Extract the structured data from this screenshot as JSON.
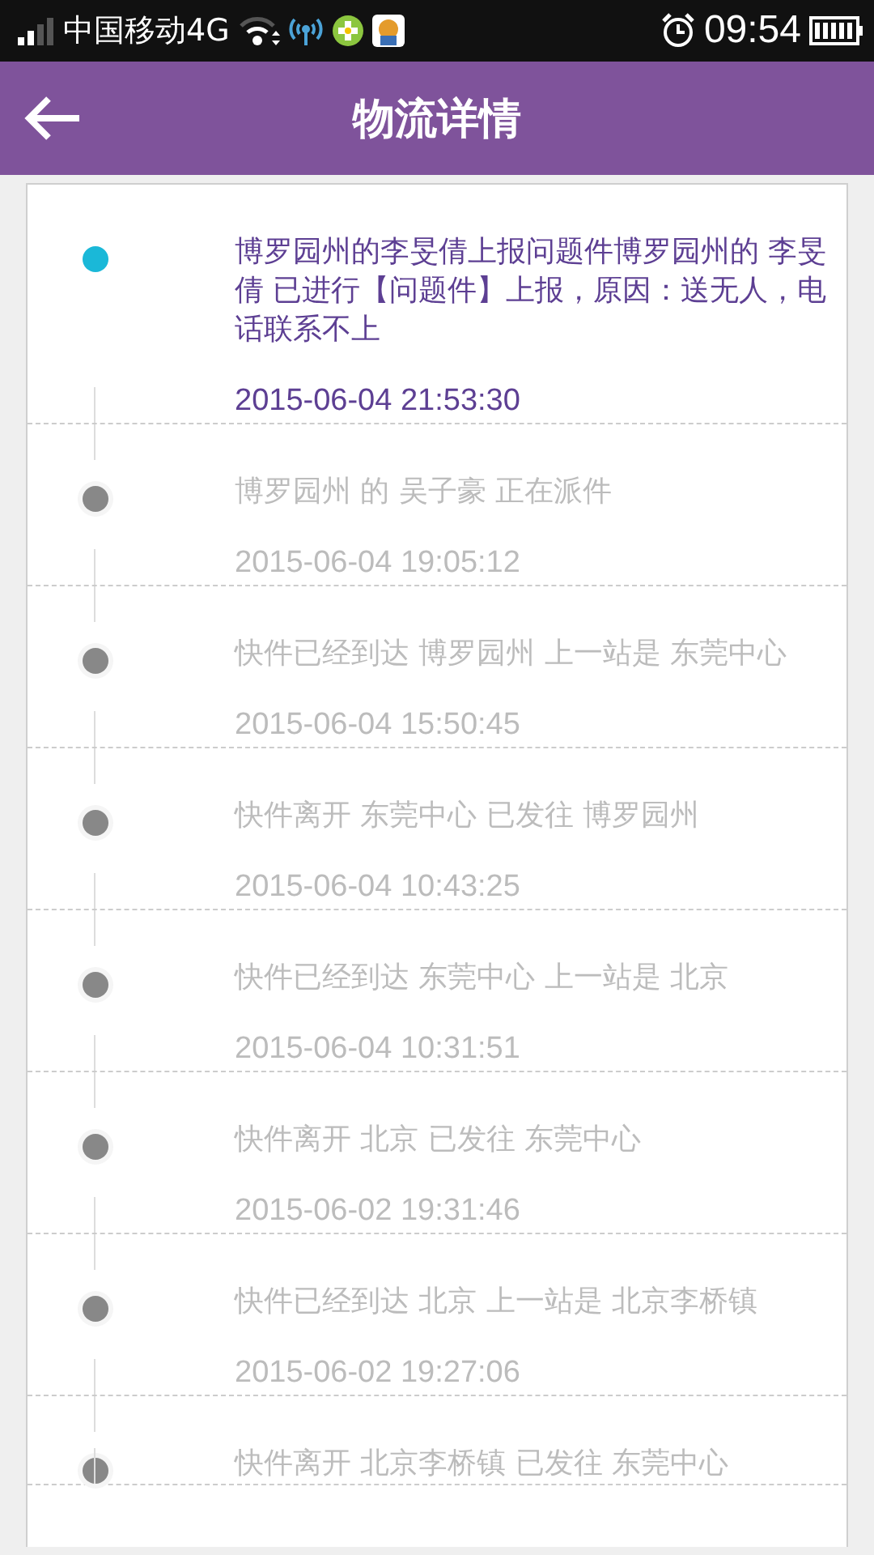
{
  "status_bar": {
    "carrier": "中国移动4G",
    "time": "09:54"
  },
  "header": {
    "title": "物流详情"
  },
  "events": [
    {
      "text": "博罗园州的李旻倩上报问题件博罗园州的 李旻倩 已进行【问题件】上报，原因：送无人，电话联系不上",
      "time": "2015-06-04 21:53:30",
      "current": true
    },
    {
      "text": "博罗园州 的 吴子豪 正在派件",
      "time": "2015-06-04 19:05:12",
      "current": false
    },
    {
      "text": "快件已经到达 博罗园州 上一站是 东莞中心",
      "time": "2015-06-04 15:50:45",
      "current": false
    },
    {
      "text": "快件离开 东莞中心 已发往 博罗园州",
      "time": "2015-06-04 10:43:25",
      "current": false
    },
    {
      "text": "快件已经到达 东莞中心 上一站是 北京",
      "time": "2015-06-04 10:31:51",
      "current": false
    },
    {
      "text": "快件离开 北京 已发往 东莞中心",
      "time": "2015-06-02 19:31:46",
      "current": false
    },
    {
      "text": "快件已经到达 北京 上一站是 北京李桥镇",
      "time": "2015-06-02 19:27:06",
      "current": false
    },
    {
      "text": "快件离开 北京李桥镇 已发往 东莞中心",
      "current": false
    }
  ]
}
